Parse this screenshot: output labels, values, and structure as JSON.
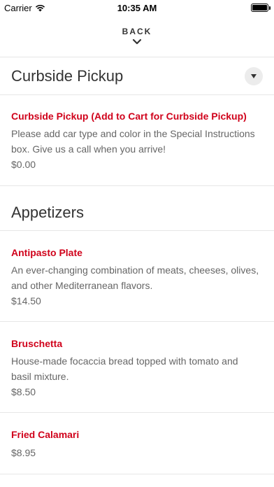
{
  "status_bar": {
    "carrier": "Carrier",
    "time": "10:35 AM"
  },
  "nav": {
    "back_label": "BACK"
  },
  "sections": [
    {
      "title": "Curbside Pickup",
      "items": [
        {
          "name": "Curbside Pickup (Add to Cart for Curbside Pickup)",
          "description": "Please add car type and color in the Special Instructions box. Give us a call when you arrive!",
          "price": "$0.00"
        }
      ]
    },
    {
      "title": "Appetizers",
      "items": [
        {
          "name": "Antipasto Plate",
          "description": "An ever-changing combination of meats, cheeses, olives, and other Mediterranean flavors.",
          "price": "$14.50"
        },
        {
          "name": "Bruschetta",
          "description": "House-made focaccia bread topped with tomato and basil mixture.",
          "price": "$8.50"
        },
        {
          "name": "Fried Calamari",
          "description": "",
          "price": "$8.95"
        }
      ]
    }
  ],
  "colors": {
    "accent": "#d0021b",
    "text": "#333333",
    "muted": "#666666",
    "divider": "#e6e6e6"
  },
  "icons": [
    "wifi-icon",
    "battery-icon",
    "chevron-down-icon",
    "dropdown-caret-icon"
  ]
}
